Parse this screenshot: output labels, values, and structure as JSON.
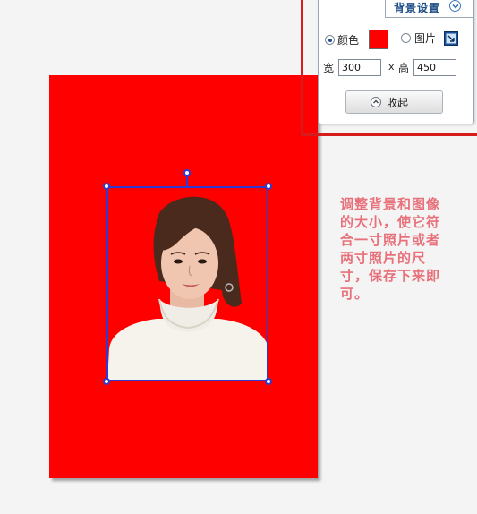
{
  "panel": {
    "title": "背景设置",
    "options": {
      "color_label": "颜色",
      "image_label": "图片",
      "selected": "color"
    },
    "background_color": "#ff0000",
    "size": {
      "width_label": "宽",
      "width_value": "300",
      "times": "x",
      "height_label": "高",
      "height_value": "450"
    },
    "collapse_label": "收起"
  },
  "canvas": {
    "color": "#ff0000"
  },
  "note": "调整背景和图像的大小，使它符合一寸照片或者两寸照片的尺寸，保存下来即可。",
  "icons": {
    "toggle": "chevron-down-icon",
    "collapse": "chevron-up-icon",
    "picker": "image-picker-icon"
  }
}
